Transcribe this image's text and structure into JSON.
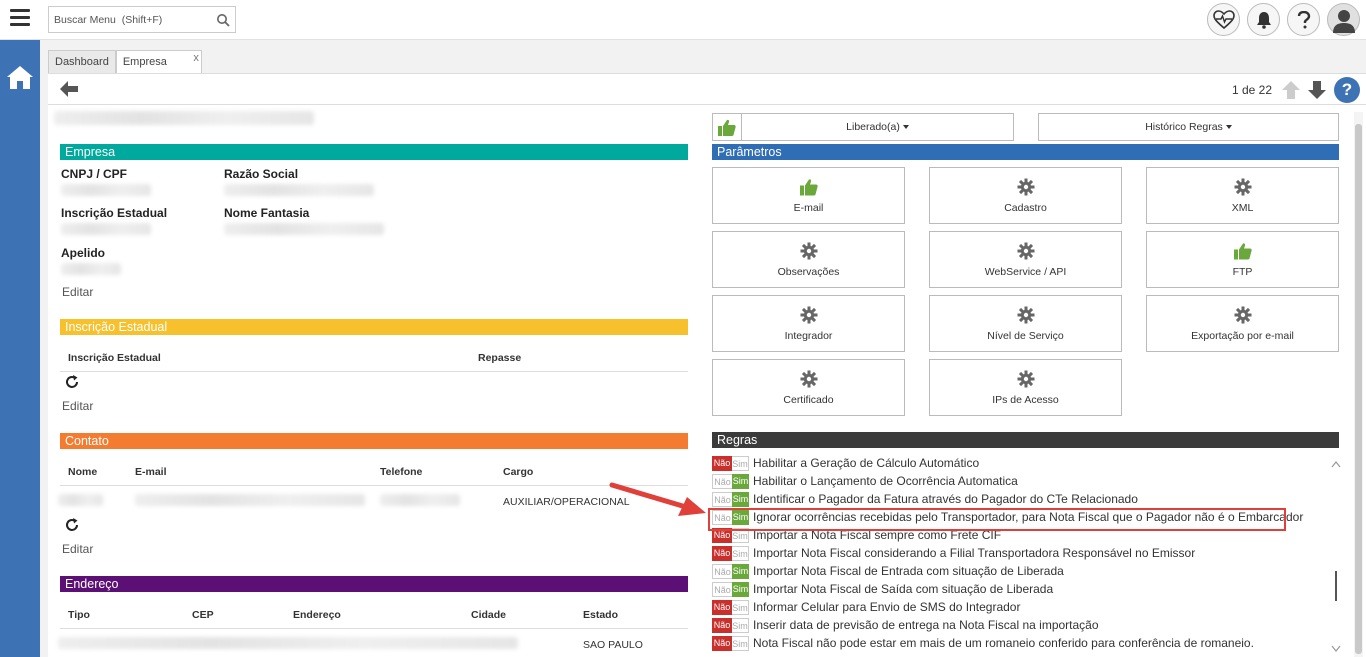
{
  "topbar": {
    "search_placeholder": "Buscar Menu  (Shift+F)"
  },
  "tabs": [
    {
      "label": "Dashboard",
      "active": false
    },
    {
      "label": "Empresa",
      "active": true
    }
  ],
  "tab_close": "x",
  "paging": "1 de 22",
  "help": "?",
  "empresa": {
    "header": "Empresa",
    "color": "#00a99d",
    "cnpj_label": "CNPJ / CPF",
    "razao_label": "Razão Social",
    "ie_label": "Inscrição Estadual",
    "fantasia_label": "Nome Fantasia",
    "apelido_label": "Apelido",
    "edit": "Editar"
  },
  "inscricao": {
    "header": "Inscrição Estadual",
    "color": "#f7c12e",
    "columns": [
      "Inscrição Estadual",
      "Repasse"
    ],
    "edit": "Editar"
  },
  "contato": {
    "header": "Contato",
    "color": "#f47c30",
    "columns": [
      "Nome",
      "E-mail",
      "Telefone",
      "Cargo"
    ],
    "row_cargo": "AUXILIAR/OPERACIONAL",
    "edit": "Editar"
  },
  "endereco": {
    "header": "Endereço",
    "color": "#5c0f74",
    "columns": [
      "Tipo",
      "CEP",
      "Endereço",
      "Cidade",
      "Estado"
    ],
    "row_estado": "SAO PAULO"
  },
  "status": {
    "liberado": "Liberado(a)",
    "historico": "Histórico Regras"
  },
  "parametros": {
    "header": "Parâmetros",
    "color": "#2f6db5",
    "tiles": [
      {
        "label": "E-mail",
        "icon": "thumbs-up-icon"
      },
      {
        "label": "Cadastro",
        "icon": "gear-icon"
      },
      {
        "label": "XML",
        "icon": "gear-icon"
      },
      {
        "label": "Observações",
        "icon": "gear-icon"
      },
      {
        "label": "WebService / API",
        "icon": "gear-icon"
      },
      {
        "label": "FTP",
        "icon": "thumbs-up-icon"
      },
      {
        "label": "Integrador",
        "icon": "gear-icon"
      },
      {
        "label": "Nível de Serviço",
        "icon": "gear-icon"
      },
      {
        "label": "Exportação por e-mail",
        "icon": "gear-icon"
      },
      {
        "label": "Certificado",
        "icon": "gear-icon"
      },
      {
        "label": "IPs de Acesso",
        "icon": "gear-icon"
      }
    ]
  },
  "regras": {
    "header": "Regras",
    "color": "#3b3b3b",
    "nao": "Não",
    "sim": "Sim",
    "items": [
      {
        "text": "Habilitar a Geração de Cálculo Automático",
        "value": "nao"
      },
      {
        "text": "Habilitar o Lançamento de Ocorrência Automatica",
        "value": "sim"
      },
      {
        "text": "Identificar o Pagador da Fatura através do Pagador do CTe Relacionado",
        "value": "sim"
      },
      {
        "text": "Ignorar ocorrências recebidas pelo Transportador, para Nota Fiscal que o Pagador não é o Embarcador",
        "value": "sim"
      },
      {
        "text": "Importar a Nota Fiscal sempre como Frete CIF",
        "value": "nao"
      },
      {
        "text": "Importar Nota Fiscal considerando a Filial Transportadora Responsável no Emissor",
        "value": "nao"
      },
      {
        "text": "Importar Nota Fiscal de Entrada com situação de Liberada",
        "value": "sim"
      },
      {
        "text": "Importar Nota Fiscal de Saída com situação de Liberada",
        "value": "sim"
      },
      {
        "text": "Informar Celular para Envio de SMS do Integrador",
        "value": "nao"
      },
      {
        "text": "Inserir data de previsão de entrega na Nota Fiscal na importação",
        "value": "nao"
      },
      {
        "text": "Nota Fiscal não pode estar em mais de um romaneio conferido para conferência de romaneio.",
        "value": "nao"
      }
    ]
  },
  "colors": {
    "rail": "#3d73b4",
    "nao_on": "#c9302c",
    "sim_on": "#6aa83c",
    "highlight": "#e0403a"
  }
}
